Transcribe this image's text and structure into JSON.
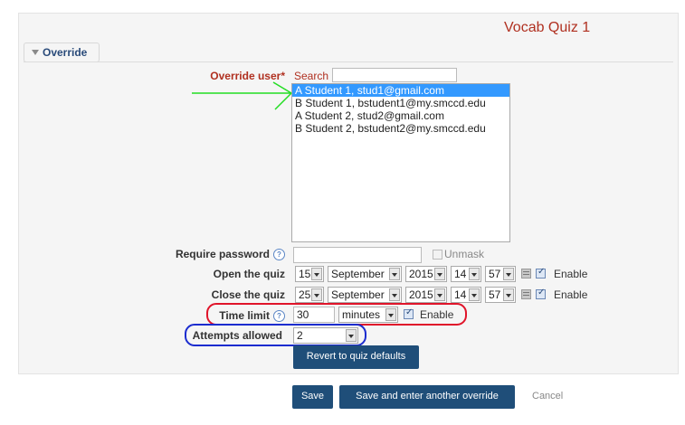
{
  "quiz_title": "Vocab Quiz 1",
  "section": {
    "label": "Override"
  },
  "override_user": {
    "label": "Override user*",
    "search_label": "Search",
    "search_value": "",
    "users": [
      "A Student 1, stud1@gmail.com",
      "B Student 1, bstudent1@my.smccd.edu",
      "A Student 2, stud2@gmail.com",
      "B Student 2, bstudent2@my.smccd.edu"
    ],
    "selected_index": 0
  },
  "require_password": {
    "label": "Require password",
    "value": "",
    "unmask_label": "Unmask"
  },
  "open_quiz": {
    "label": "Open the quiz",
    "day": "15",
    "month": "September",
    "year": "2015",
    "hour": "14",
    "minute": "57",
    "enable_label": "Enable"
  },
  "close_quiz": {
    "label": "Close the quiz",
    "day": "25",
    "month": "September",
    "year": "2015",
    "hour": "14",
    "minute": "57",
    "enable_label": "Enable"
  },
  "time_limit": {
    "label": "Time limit",
    "value": "30",
    "unit": "minutes",
    "enable_label": "Enable"
  },
  "attempts": {
    "label": "Attempts allowed",
    "value": "2"
  },
  "buttons": {
    "revert": "Revert to quiz defaults",
    "save": "Save",
    "save_another": "Save and enter another override",
    "cancel": "Cancel"
  },
  "colors": {
    "button": "#1f4e79",
    "required": "#b03020",
    "selection": "#3399ff",
    "highlight_red": "#e0142a",
    "highlight_blue": "#1b2ccf",
    "arrow_green": "#22dd22"
  }
}
